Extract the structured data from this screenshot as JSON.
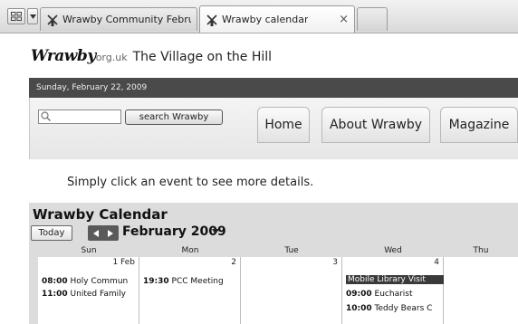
{
  "browser": {
    "tabs": [
      {
        "label": "Wrawby Community Februar...",
        "active": false
      },
      {
        "label": "Wrawby calendar",
        "active": true,
        "close": "×"
      }
    ]
  },
  "site": {
    "logo": "Wrawby",
    "domain": "org.uk",
    "tagline": "The Village on the Hill",
    "date": "Sunday, February 22, 2009",
    "search_placeholder": "",
    "search_button": "search Wrawby",
    "nav": [
      "Home",
      "About Wrawby",
      "Magazine"
    ]
  },
  "hint": "Simply click an event to see more details.",
  "calendar": {
    "title": "Wrawby Calendar",
    "today_label": "Today",
    "month_label": "February 2009",
    "days": [
      "Sun",
      "Mon",
      "Tue",
      "Wed",
      "Thu"
    ],
    "cells": [
      {
        "num": "1 Feb",
        "events": [
          {
            "time": "08:00",
            "text": "Holy Commun"
          },
          {
            "time": "11:00",
            "text": "United Family"
          }
        ]
      },
      {
        "num": "2",
        "events": [
          {
            "time": "19:30",
            "text": "PCC Meeting"
          }
        ]
      },
      {
        "num": "3",
        "events": []
      },
      {
        "num": "4",
        "events": [
          {
            "time": "",
            "text": "Mobile Library Visit",
            "highlight": true
          },
          {
            "time": "09:00",
            "text": "Eucharist"
          },
          {
            "time": "10:00",
            "text": "Teddy Bears C"
          }
        ]
      },
      {
        "num": "",
        "events": []
      }
    ]
  }
}
